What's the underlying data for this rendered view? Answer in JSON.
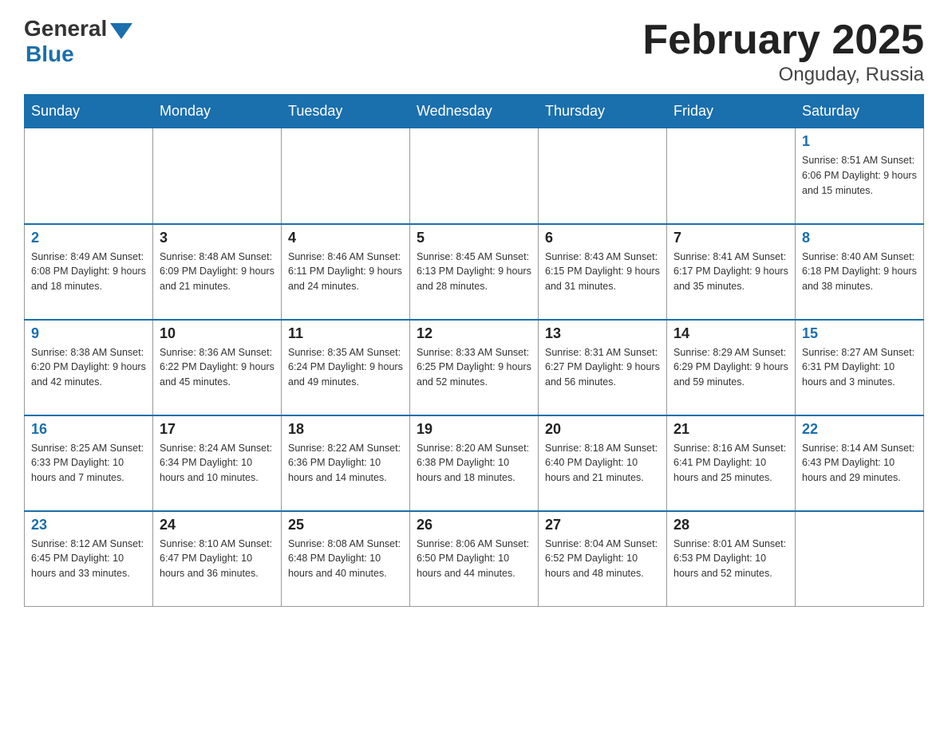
{
  "logo": {
    "general": "General",
    "blue": "Blue"
  },
  "title": "February 2025",
  "subtitle": "Onguday, Russia",
  "weekdays": [
    "Sunday",
    "Monday",
    "Tuesday",
    "Wednesday",
    "Thursday",
    "Friday",
    "Saturday"
  ],
  "weeks": [
    [
      {
        "day": "",
        "info": ""
      },
      {
        "day": "",
        "info": ""
      },
      {
        "day": "",
        "info": ""
      },
      {
        "day": "",
        "info": ""
      },
      {
        "day": "",
        "info": ""
      },
      {
        "day": "",
        "info": ""
      },
      {
        "day": "1",
        "info": "Sunrise: 8:51 AM\nSunset: 6:06 PM\nDaylight: 9 hours and 15 minutes."
      }
    ],
    [
      {
        "day": "2",
        "info": "Sunrise: 8:49 AM\nSunset: 6:08 PM\nDaylight: 9 hours and 18 minutes."
      },
      {
        "day": "3",
        "info": "Sunrise: 8:48 AM\nSunset: 6:09 PM\nDaylight: 9 hours and 21 minutes."
      },
      {
        "day": "4",
        "info": "Sunrise: 8:46 AM\nSunset: 6:11 PM\nDaylight: 9 hours and 24 minutes."
      },
      {
        "day": "5",
        "info": "Sunrise: 8:45 AM\nSunset: 6:13 PM\nDaylight: 9 hours and 28 minutes."
      },
      {
        "day": "6",
        "info": "Sunrise: 8:43 AM\nSunset: 6:15 PM\nDaylight: 9 hours and 31 minutes."
      },
      {
        "day": "7",
        "info": "Sunrise: 8:41 AM\nSunset: 6:17 PM\nDaylight: 9 hours and 35 minutes."
      },
      {
        "day": "8",
        "info": "Sunrise: 8:40 AM\nSunset: 6:18 PM\nDaylight: 9 hours and 38 minutes."
      }
    ],
    [
      {
        "day": "9",
        "info": "Sunrise: 8:38 AM\nSunset: 6:20 PM\nDaylight: 9 hours and 42 minutes."
      },
      {
        "day": "10",
        "info": "Sunrise: 8:36 AM\nSunset: 6:22 PM\nDaylight: 9 hours and 45 minutes."
      },
      {
        "day": "11",
        "info": "Sunrise: 8:35 AM\nSunset: 6:24 PM\nDaylight: 9 hours and 49 minutes."
      },
      {
        "day": "12",
        "info": "Sunrise: 8:33 AM\nSunset: 6:25 PM\nDaylight: 9 hours and 52 minutes."
      },
      {
        "day": "13",
        "info": "Sunrise: 8:31 AM\nSunset: 6:27 PM\nDaylight: 9 hours and 56 minutes."
      },
      {
        "day": "14",
        "info": "Sunrise: 8:29 AM\nSunset: 6:29 PM\nDaylight: 9 hours and 59 minutes."
      },
      {
        "day": "15",
        "info": "Sunrise: 8:27 AM\nSunset: 6:31 PM\nDaylight: 10 hours and 3 minutes."
      }
    ],
    [
      {
        "day": "16",
        "info": "Sunrise: 8:25 AM\nSunset: 6:33 PM\nDaylight: 10 hours and 7 minutes."
      },
      {
        "day": "17",
        "info": "Sunrise: 8:24 AM\nSunset: 6:34 PM\nDaylight: 10 hours and 10 minutes."
      },
      {
        "day": "18",
        "info": "Sunrise: 8:22 AM\nSunset: 6:36 PM\nDaylight: 10 hours and 14 minutes."
      },
      {
        "day": "19",
        "info": "Sunrise: 8:20 AM\nSunset: 6:38 PM\nDaylight: 10 hours and 18 minutes."
      },
      {
        "day": "20",
        "info": "Sunrise: 8:18 AM\nSunset: 6:40 PM\nDaylight: 10 hours and 21 minutes."
      },
      {
        "day": "21",
        "info": "Sunrise: 8:16 AM\nSunset: 6:41 PM\nDaylight: 10 hours and 25 minutes."
      },
      {
        "day": "22",
        "info": "Sunrise: 8:14 AM\nSunset: 6:43 PM\nDaylight: 10 hours and 29 minutes."
      }
    ],
    [
      {
        "day": "23",
        "info": "Sunrise: 8:12 AM\nSunset: 6:45 PM\nDaylight: 10 hours and 33 minutes."
      },
      {
        "day": "24",
        "info": "Sunrise: 8:10 AM\nSunset: 6:47 PM\nDaylight: 10 hours and 36 minutes."
      },
      {
        "day": "25",
        "info": "Sunrise: 8:08 AM\nSunset: 6:48 PM\nDaylight: 10 hours and 40 minutes."
      },
      {
        "day": "26",
        "info": "Sunrise: 8:06 AM\nSunset: 6:50 PM\nDaylight: 10 hours and 44 minutes."
      },
      {
        "day": "27",
        "info": "Sunrise: 8:04 AM\nSunset: 6:52 PM\nDaylight: 10 hours and 48 minutes."
      },
      {
        "day": "28",
        "info": "Sunrise: 8:01 AM\nSunset: 6:53 PM\nDaylight: 10 hours and 52 minutes."
      },
      {
        "day": "",
        "info": ""
      }
    ]
  ]
}
